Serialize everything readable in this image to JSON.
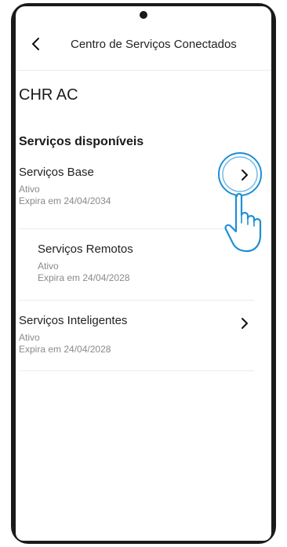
{
  "header": {
    "title": "Centro de Serviços Conectados"
  },
  "device": {
    "name": "CHR AC"
  },
  "section": {
    "title": "Serviços disponíveis"
  },
  "services": [
    {
      "name": "Serviços Base",
      "status": "Ativo",
      "expiry": "Expira em 24/04/2034",
      "has_chevron": true
    },
    {
      "name": "Serviços Remotos",
      "status": "Ativo",
      "expiry": "Expira em 24/04/2028",
      "has_chevron": false
    },
    {
      "name": "Serviços Inteligentes",
      "status": "Ativo",
      "expiry": "Expira em 24/04/2028",
      "has_chevron": true
    }
  ],
  "icons": {
    "back": "chevron-left-icon",
    "row_chevron": "chevron-right-icon",
    "tap_hint": "hand-pointer-icon"
  },
  "colors": {
    "accent": "#1e8fd6",
    "text": "#222222",
    "muted": "#8a8a8a",
    "divider": "#ececec"
  }
}
